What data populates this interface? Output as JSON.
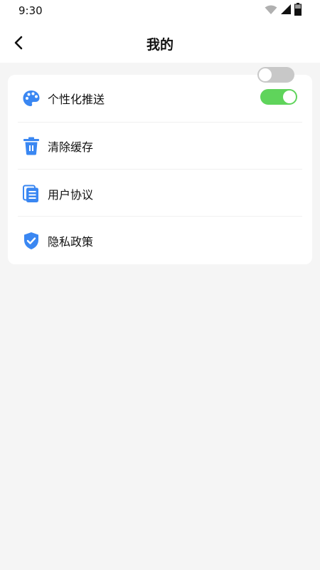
{
  "status_bar": {
    "time": "9:30",
    "icons": [
      "wifi-icon",
      "cell-signal-icon",
      "battery-icon"
    ]
  },
  "header": {
    "back_icon": "chevron-left-icon",
    "title": "我的"
  },
  "settings": {
    "items": [
      {
        "label": "个性化推送",
        "icon": "palette-icon",
        "toggle": true
      },
      {
        "label": "清除缓存",
        "icon": "trash-icon"
      },
      {
        "label": "用户协议",
        "icon": "document-icon"
      },
      {
        "label": "隐私政策",
        "icon": "shield-check-icon"
      }
    ],
    "floating_toggle_state": false
  },
  "colors": {
    "accent_blue": "#3a87f2",
    "toggle_on": "#5fd45b",
    "toggle_off": "#c8c8c8",
    "background": "#f5f5f5"
  }
}
